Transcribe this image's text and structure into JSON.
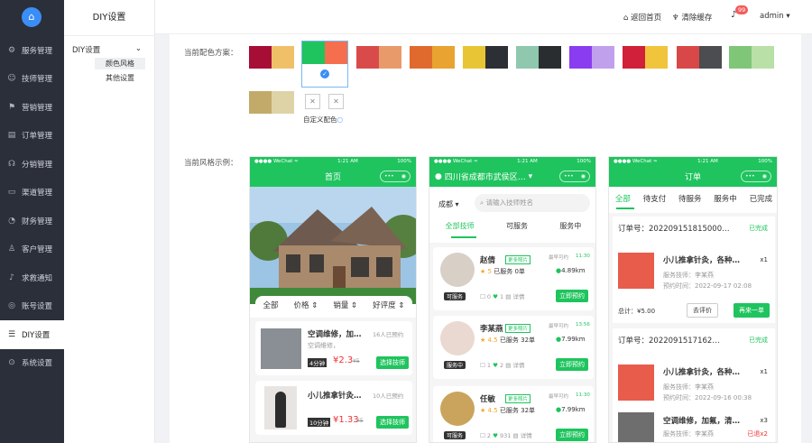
{
  "app": {
    "logo_glyph": "⌂"
  },
  "sidebar": {
    "items": [
      {
        "icon": "⚙",
        "label": "服务管理"
      },
      {
        "icon": "☺",
        "label": "技师管理"
      },
      {
        "icon": "⚑",
        "label": "营销管理"
      },
      {
        "icon": "▤",
        "label": "订单管理"
      },
      {
        "icon": "☊",
        "label": "分销管理"
      },
      {
        "icon": "▭",
        "label": "渠道管理"
      },
      {
        "icon": "◔",
        "label": "财务管理"
      },
      {
        "icon": "♙",
        "label": "客户管理"
      },
      {
        "icon": "♪",
        "label": "求救通知"
      },
      {
        "icon": "◎",
        "label": "账号设置"
      },
      {
        "icon": "☰",
        "label": "DIY设置"
      },
      {
        "icon": "⊙",
        "label": "系统设置"
      }
    ]
  },
  "submenu": {
    "title": "DIY设置",
    "group": "DIY设置",
    "items": [
      "颜色风格",
      "其他设置"
    ]
  },
  "topbar": {
    "home": "返回首页",
    "clear": "清除缓存",
    "badge": "99",
    "user": "admin"
  },
  "colors": {
    "label": "当前配色方案：",
    "custom": "自定义配色",
    "swatches": [
      [
        "#a60e36",
        "#f0c069"
      ],
      [
        "#1fc45e",
        "#f56e4e"
      ],
      [
        "#d94b4b",
        "#e89a6a"
      ],
      [
        "#e06a2d",
        "#e8a330"
      ],
      [
        "#e8c535",
        "#2c2f33"
      ],
      [
        "#8fc8ae",
        "#2a2d30"
      ],
      [
        "#8a3cf0",
        "#c0a0ec"
      ],
      [
        "#d1203a",
        "#f0c53b"
      ],
      [
        "#d84848",
        "#4b4d50"
      ],
      [
        "#7fc679",
        "#b8e0a7"
      ],
      [
        "#c2aa6a",
        "#ded3a6"
      ]
    ]
  },
  "style": {
    "label": "当前风格示例："
  },
  "phone1": {
    "status_left": "●●●● WeChat ≈",
    "status_time": "1:21 AM",
    "status_right": "100%",
    "title": "首页",
    "filters": [
      "全部",
      "价格",
      "销量",
      "好评度"
    ],
    "items": [
      {
        "name": "空调维修，加…",
        "booked": "16人已预约",
        "sub": "空调维修，",
        "time": "4分钟",
        "price": "¥2.3",
        "old": "¥5",
        "btn": "选择技师"
      },
      {
        "name": "小儿推拿针灸…",
        "booked": "10人已预约",
        "sub": "",
        "time": "10分钟",
        "price": "¥1.33",
        "old": "¥5",
        "btn": "选择技师"
      }
    ]
  },
  "phone2": {
    "status_left": "●●●● WeChat ≈",
    "status_time": "1:21 AM",
    "status_right": "100%",
    "location": "四川省成都市武侯区…",
    "city": "成都",
    "search": "请输入技师姓名",
    "tabs": [
      "全部技师",
      "可服务",
      "服务中"
    ],
    "techs": [
      {
        "name": "赵倩",
        "more": "更多照片",
        "label": "最早可约",
        "time": "11:30",
        "rating": "5",
        "served": "已服务 0单",
        "dist": "4.89km",
        "state": "可服务",
        "c": "0",
        "l": "1",
        "btn": "立即预约"
      },
      {
        "name": "李某燕",
        "more": "更多照片",
        "label": "最早可约",
        "time": "13:56",
        "rating": "4.5",
        "served": "已服务 32单",
        "dist": "7.99km",
        "state": "服务中",
        "c": "1",
        "l": "2",
        "btn": "立即预约"
      },
      {
        "name": "任敏",
        "more": "更多照片",
        "label": "最早可约",
        "time": "11:30",
        "rating": "4.5",
        "served": "已服务 32单",
        "dist": "7.99km",
        "state": "可服务",
        "c": "2",
        "l": "931",
        "btn": "立即预约"
      }
    ],
    "cmt": "详情"
  },
  "phone3": {
    "status_left": "●●●● WeChat ≈",
    "status_time": "1:21 AM",
    "status_right": "100%",
    "title": "订单",
    "tabs": [
      "全部",
      "待支付",
      "待服务",
      "服务中",
      "已完成"
    ],
    "orders": [
      {
        "no": "订单号：202209151815000…",
        "status": "已完成",
        "name": "小儿推拿针灸，各种…",
        "qty": "x1",
        "tech": "服务技师：李某燕",
        "time": "预约时间：2022-09-17 02:08",
        "total": "总计：¥5.00",
        "b1": "去评价",
        "b2": "再来一单"
      },
      {
        "no": "订单号：2022091517162…",
        "status": "已完成",
        "name": "小儿推拿针灸，各种…",
        "qty": "x1",
        "tech": "服务技师：李某燕",
        "time": "预约时间：2022-09-16 00:38"
      },
      {
        "name": "空调维修，加氟，清…",
        "qty": "x3",
        "tech": "服务技师：李某燕",
        "refund": "已退x2"
      }
    ]
  }
}
